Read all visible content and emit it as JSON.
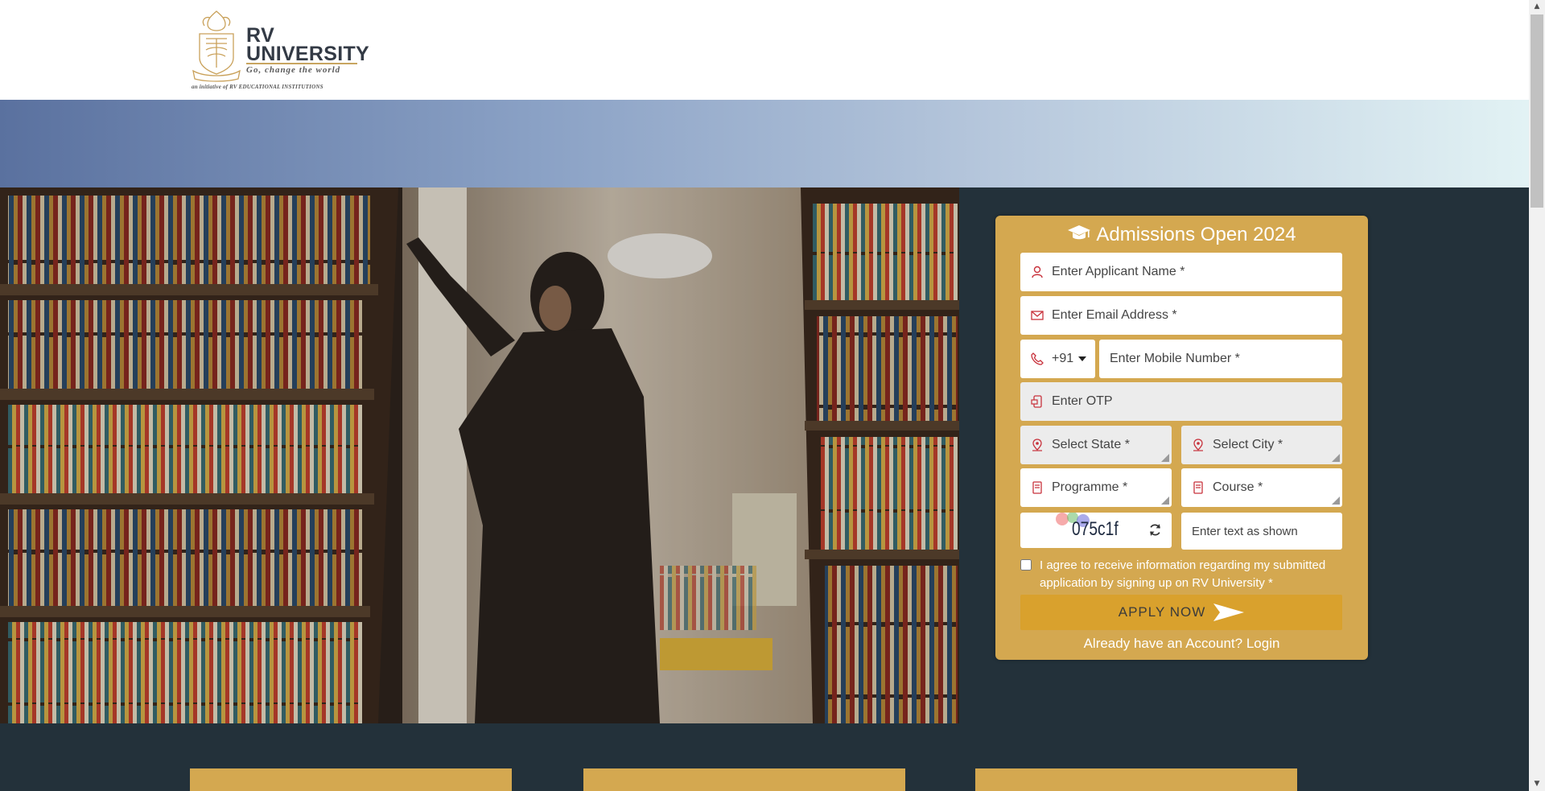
{
  "header": {
    "logo_line1": "RV",
    "logo_line2": "UNIVERSITY",
    "tagline": "Go, change the world",
    "subline": "an initiative of RV EDUCATIONAL INSTITUTIONS"
  },
  "form": {
    "title": "Admissions Open 2024",
    "name_placeholder": "Enter Applicant Name *",
    "email_placeholder": "Enter Email Address *",
    "country_code": "+91",
    "mobile_placeholder": "Enter Mobile Number *",
    "otp_placeholder": "Enter OTP",
    "state_label": "Select State *",
    "city_label": "Select City *",
    "programme_label": "Programme *",
    "course_label": "Course *",
    "captcha_code": "075c1f",
    "captcha_placeholder": "Enter text as shown",
    "agree_text": "I agree to receive information regarding my submitted application by signing up on RV University *",
    "apply_label": "APPLY NOW",
    "login_text": "Already have an Account? Login"
  },
  "colors": {
    "card": "#d4a850",
    "button": "#d9a12d",
    "dark_bg": "#23313a",
    "icon_red": "#c8323c"
  },
  "icons": {
    "title": "graduation-cap-icon",
    "name": "user-icon",
    "email": "envelope-icon",
    "phone": "phone-icon",
    "otp": "mobile-otp-icon",
    "location": "location-pin-icon",
    "book": "book-icon",
    "refresh": "refresh-icon",
    "apply": "send-arrow-icon"
  }
}
